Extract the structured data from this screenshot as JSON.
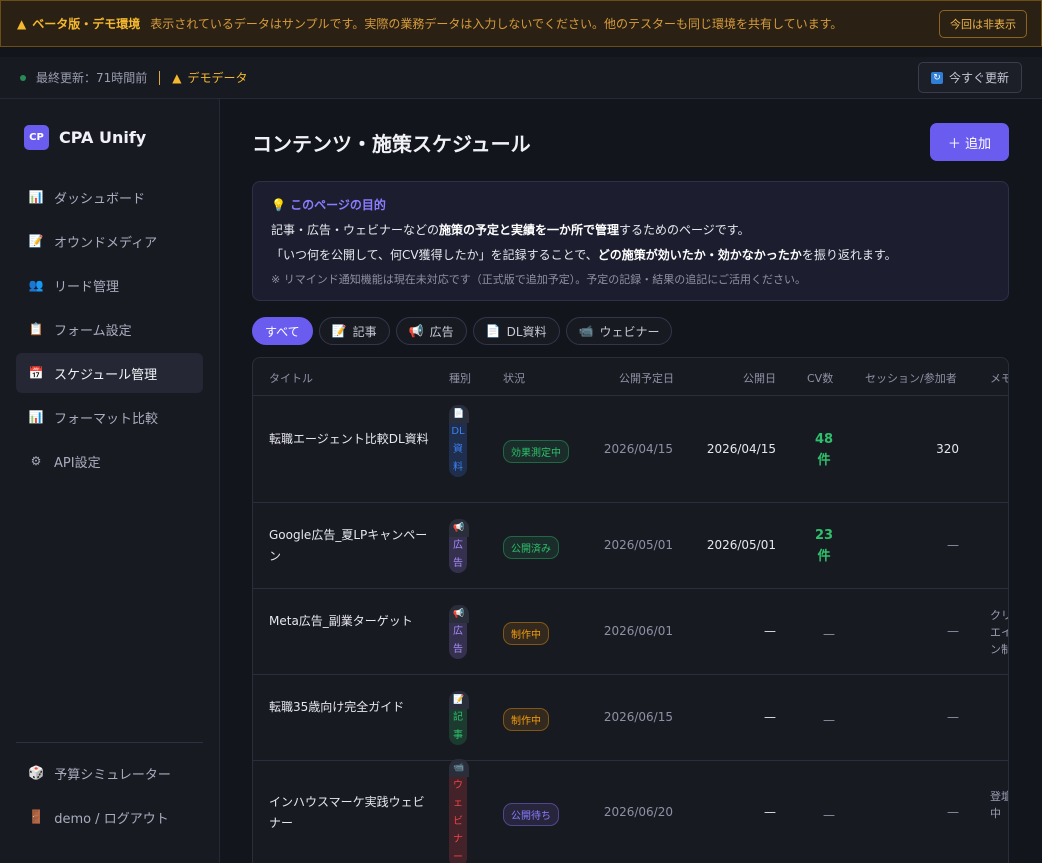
{
  "beta": {
    "icon": "warning-icon",
    "title": "ベータ版・デモ環境",
    "message": "表示されているデータはサンプルです。実際の業務データは入力しないでください。他のテスターも同じ環境を共有しています。",
    "hide_label": "今回は非表示"
  },
  "status": {
    "last_update": "最終更新：71時間前",
    "demo": "デモデータ",
    "refresh": "今すぐ更新"
  },
  "brand": {
    "logo": "CP",
    "name": "CPA Unify"
  },
  "nav": [
    {
      "icon": "bar-chart-icon",
      "glyph": "📊",
      "label": "ダッシュボード"
    },
    {
      "icon": "memo-icon",
      "glyph": "📝",
      "label": "オウンドメディア"
    },
    {
      "icon": "users-icon",
      "glyph": "👥",
      "label": "リード管理"
    },
    {
      "icon": "clipboard-icon",
      "glyph": "📋",
      "label": "フォーム設定"
    },
    {
      "icon": "calendar-icon",
      "glyph": "📅",
      "label": "スケジュール管理"
    },
    {
      "icon": "bar-chart-icon",
      "glyph": "📊",
      "label": "フォーマット比較"
    },
    {
      "icon": "gear-icon",
      "glyph": "⚙",
      "label": "API設定"
    }
  ],
  "bottom": [
    {
      "icon": "dice-icon",
      "glyph": "🎲",
      "label": "予算シミュレーター"
    },
    {
      "icon": "door-icon",
      "glyph": "🚪",
      "label": "demo / ログアウト"
    }
  ],
  "page": {
    "title": "コンテンツ・施策スケジュール",
    "add": "＋ 追加"
  },
  "purpose": {
    "heading": "このページの目的",
    "l1a": "記事・広告・ウェビナーなどの",
    "l1b": "施策の予定と実績を一か所で管理",
    "l1c": "するためのページです。",
    "l2a": "「いつ何を公開して、何CV獲得したか」を記録することで、",
    "l2b": "どの施策が効いたか・効かなかったか",
    "l2c": "を振り返れます。",
    "note": "※ リマインド通知機能は現在未対応です（正式版で追加予定）。予定の記録・結果の追記にご活用ください。"
  },
  "filters": [
    {
      "icon": "",
      "glyph": "",
      "label": "すべて"
    },
    {
      "icon": "memo-icon",
      "glyph": "📝",
      "label": "記事"
    },
    {
      "icon": "megaphone-icon",
      "glyph": "📢",
      "label": "広告"
    },
    {
      "icon": "document-icon",
      "glyph": "📄",
      "label": "DL資料"
    },
    {
      "icon": "video-camera-icon",
      "glyph": "📹",
      "label": "ウェビナー"
    }
  ],
  "table": {
    "headers": {
      "title": "タイトル",
      "type": "種別",
      "status": "状況",
      "scheduled": "公開予定日",
      "published": "公開日",
      "cv": "CV数",
      "sessions": "セッション/参加者",
      "memo": "メモ"
    },
    "rows": [
      {
        "title": "転職エージェント比較DL資料",
        "type_icon": "document-icon",
        "type_glyph": "📄",
        "type_label": "DL資料",
        "type_color": "#3b82f6",
        "status": "効果測定中",
        "status_color": "#2ec06b",
        "scheduled": "2026/04/15",
        "published": "2026/04/15",
        "cv": "48件",
        "sessions": "320",
        "memo": ""
      },
      {
        "title": "Google広告_夏LPキャンペーン",
        "type_icon": "megaphone-icon",
        "type_glyph": "📢",
        "type_label": "広告",
        "type_color": "#a78bfa",
        "status": "公開済み",
        "status_color": "#2ec06b",
        "scheduled": "2026/05/01",
        "published": "2026/05/01",
        "cv": "23件",
        "sessions": "—",
        "memo": ""
      },
      {
        "title": "Meta広告_副業ターゲット",
        "type_icon": "megaphone-icon",
        "type_glyph": "📢",
        "type_label": "広告",
        "type_color": "#a78bfa",
        "status": "制作中",
        "status_color": "#f59e0b",
        "scheduled": "2026/06/01",
        "published": "—",
        "cv": "—",
        "sessions": "—",
        "memo": "クリエイン制"
      },
      {
        "title": "転職35歳向け完全ガイド",
        "type_icon": "memo-icon",
        "type_glyph": "📝",
        "type_label": "記事",
        "type_color": "#2ec06b",
        "status": "制作中",
        "status_color": "#f59e0b",
        "scheduled": "2026/06/15",
        "published": "—",
        "cv": "—",
        "sessions": "—",
        "memo": ""
      },
      {
        "title": "インハウスマーケ実践ウェビナー",
        "type_icon": "video-camera-icon",
        "type_glyph": "📹",
        "type_label": "ウェビナー",
        "type_color": "#ef4444",
        "status": "公開待ち",
        "status_color": "#8b7cff",
        "scheduled": "2026/06/20",
        "published": "—",
        "cv": "—",
        "sessions": "—",
        "memo": "登壇中"
      }
    ]
  }
}
